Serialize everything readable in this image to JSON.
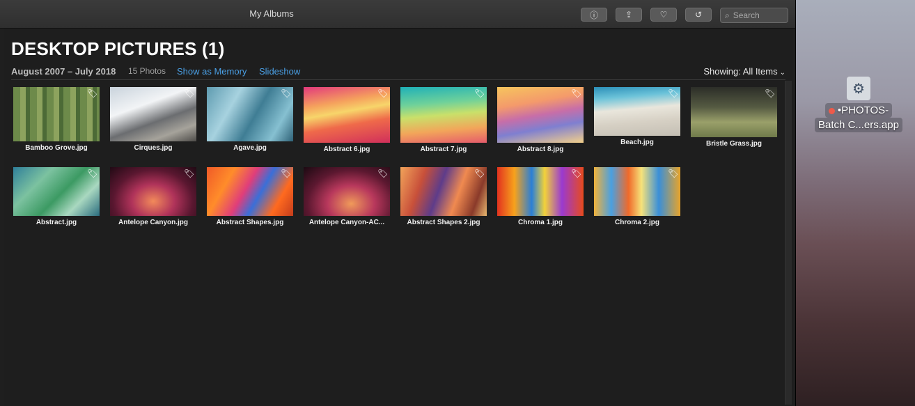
{
  "window": {
    "title": "My Albums"
  },
  "toolbar": {
    "info_icon": "info-icon",
    "share_icon": "share-icon",
    "favorite_icon": "heart-icon",
    "rotate_icon": "rotate-icon",
    "search_placeholder": "Search"
  },
  "album": {
    "title": "DESKTOP PICTURES (1)",
    "date_range": "August 2007 – July 2018",
    "photo_count": "15 Photos",
    "show_as_memory": "Show as Memory",
    "slideshow": "Slideshow",
    "showing": "Showing: All Items"
  },
  "photos": [
    {
      "name": "Bamboo Grove.jpg"
    },
    {
      "name": "Cirques.jpg"
    },
    {
      "name": "Agave.jpg"
    },
    {
      "name": "Abstract 6.jpg"
    },
    {
      "name": "Abstract 7.jpg"
    },
    {
      "name": "Abstract 8.jpg"
    },
    {
      "name": "Beach.jpg"
    },
    {
      "name": "Bristle Grass.jpg"
    },
    {
      "name": "Abstract.jpg"
    },
    {
      "name": "Antelope Canyon.jpg"
    },
    {
      "name": "Abstract Shapes.jpg"
    },
    {
      "name": "Antelope Canyon-AC..."
    },
    {
      "name": "Abstract Shapes 2.jpg"
    },
    {
      "name": "Chroma 1.jpg"
    },
    {
      "name": "Chroma 2.jpg"
    }
  ],
  "desktop": {
    "app_label_line1": "•PHOTOS-",
    "app_label_line2": "Batch C...ers.app"
  }
}
